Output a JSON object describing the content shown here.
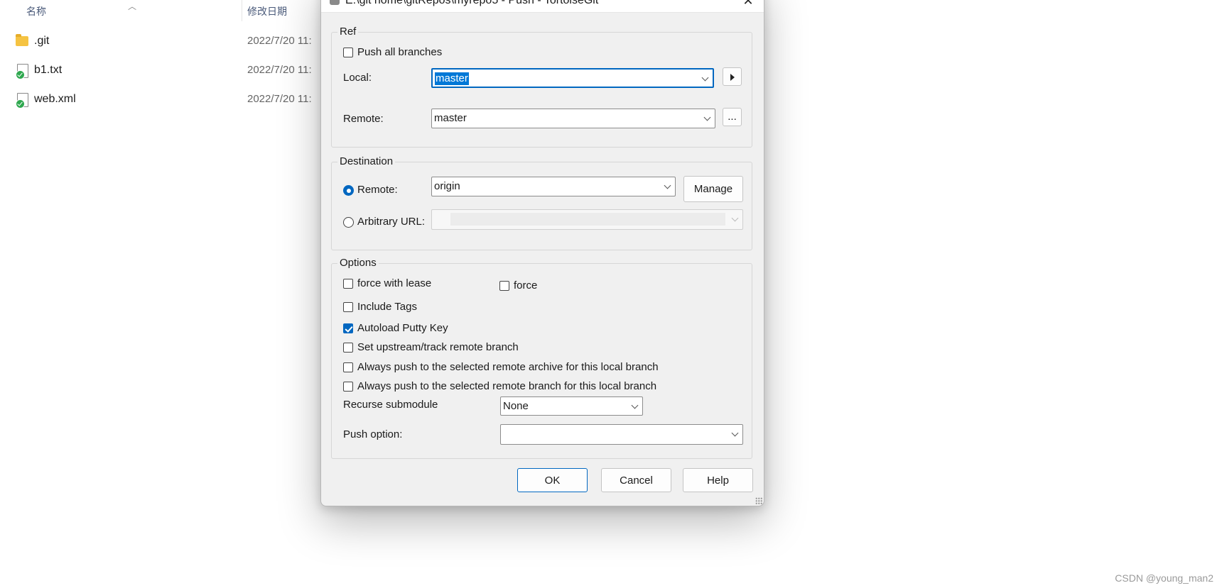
{
  "explorer": {
    "columns": {
      "name": "名称",
      "modified": "修改日期"
    },
    "files": [
      {
        "name": ".git",
        "type": "folder",
        "modified": "2022/7/20 11:"
      },
      {
        "name": "b1.txt",
        "type": "file",
        "modified": "2022/7/20 11:"
      },
      {
        "name": "web.xml",
        "type": "file",
        "modified": "2022/7/20 11:"
      }
    ]
  },
  "dialog": {
    "title": "E:\\git home\\gitRepos\\myrepo5 - Push - TortoiseGit",
    "ref": {
      "label": "Ref",
      "push_all_branches": {
        "label": "Push all branches",
        "checked": false
      },
      "local_label": "Local:",
      "local_value": "master",
      "remote_label": "Remote:",
      "remote_value": "master",
      "browse_label": "..."
    },
    "destination": {
      "label": "Destination",
      "remote_radio_label": "Remote:",
      "remote_value": "origin",
      "manage_label": "Manage",
      "arbitrary_url_label": "Arbitrary URL:",
      "arbitrary_url_value": ""
    },
    "options": {
      "label": "Options",
      "force_with_lease": {
        "label": "force with lease",
        "checked": false
      },
      "force": {
        "label": "force",
        "checked": false
      },
      "include_tags": {
        "label": "Include Tags",
        "checked": false
      },
      "autoload_putty_key": {
        "label": "Autoload Putty Key",
        "checked": true
      },
      "set_upstream": {
        "label": "Set upstream/track remote branch",
        "checked": false
      },
      "always_push_archive": {
        "label": "Always push to the selected remote archive for this local branch",
        "checked": false
      },
      "always_push_branch": {
        "label": "Always push to the selected remote branch for this local branch",
        "checked": false
      },
      "recurse_submodule_label": "Recurse submodule",
      "recurse_submodule_value": "None",
      "push_option_label": "Push option:",
      "push_option_value": ""
    },
    "buttons": {
      "ok": "OK",
      "cancel": "Cancel",
      "help": "Help"
    }
  },
  "watermark": "CSDN @young_man2",
  "colors": {
    "accent": "#0067c0",
    "dialog_bg": "#f0f0f0"
  }
}
